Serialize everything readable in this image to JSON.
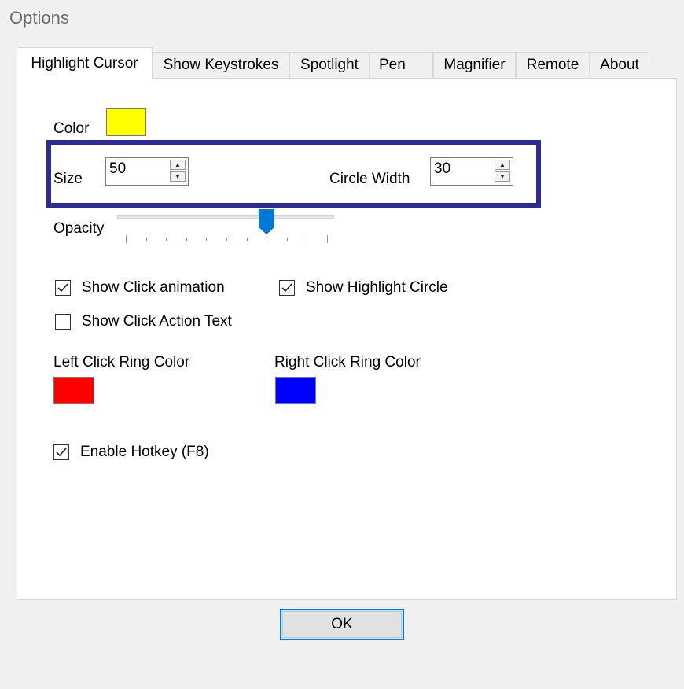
{
  "window": {
    "title": "Options"
  },
  "tabs": [
    {
      "label": "Highlight Cursor",
      "active": true
    },
    {
      "label": "Show Keystrokes",
      "active": false
    },
    {
      "label": "Spotlight",
      "active": false
    },
    {
      "label": "Pen",
      "active": false
    },
    {
      "label": "Magnifier",
      "active": false
    },
    {
      "label": "Remote",
      "active": false
    },
    {
      "label": "About",
      "active": false
    }
  ],
  "highlight_cursor": {
    "color_label": "Color",
    "color_value": "#ffff00",
    "size_label": "Size",
    "size_value": "50",
    "circle_width_label": "Circle Width",
    "circle_width_value": "30",
    "opacity_label": "Opacity",
    "opacity_level": 0.7,
    "checkboxes": {
      "show_click_animation": {
        "label": "Show Click animation",
        "checked": true
      },
      "show_highlight_circle": {
        "label": "Show Highlight Circle",
        "checked": true
      },
      "show_click_action_text": {
        "label": "Show Click Action Text",
        "checked": false
      },
      "enable_hotkey": {
        "label": "Enable Hotkey (F8)",
        "checked": true
      }
    },
    "left_click_ring_label": "Left Click Ring Color",
    "left_click_ring_color": "#ff0000",
    "right_click_ring_label": "Right Click Ring Color",
    "right_click_ring_color": "#0000ff",
    "highlight_box_color": "#2e2b94"
  },
  "footer": {
    "ok_label": "OK"
  },
  "accent_color": "#0078d7"
}
